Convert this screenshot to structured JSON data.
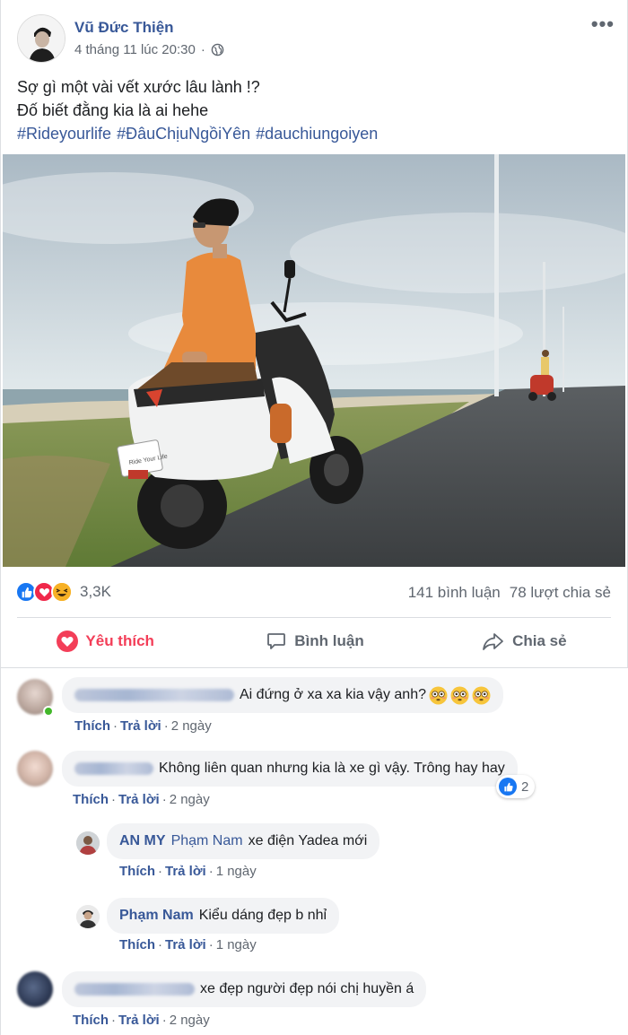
{
  "post": {
    "author": "Vũ Đức Thiện",
    "timestamp": "4 tháng 11 lúc 20:30",
    "privacy_icon": "globe-icon",
    "more_icon": "ellipsis-icon",
    "more_label": "•••",
    "caption_lines": [
      "Sợ gì một vài vết xước lâu lành !?",
      "Đố biết đằng kia là ai hehe"
    ],
    "hashtags": [
      "#Rideyourlife",
      "#ĐâuChịuNgồiYên",
      "#dauchiungoiyen"
    ],
    "photo_plate_text": "Ride Your Life"
  },
  "stats": {
    "reactions": [
      "like",
      "love",
      "haha"
    ],
    "reaction_count": "3,3K",
    "comments": "141 bình luận",
    "shares": "78 lượt chia sẻ"
  },
  "actions": {
    "like": "Yêu thích",
    "comment": "Bình luận",
    "share": "Chia sẻ"
  },
  "colors": {
    "link": "#385898",
    "love": "#f33e58",
    "like": "#1877f2",
    "muted": "#606770",
    "bubble": "#f2f3f5"
  },
  "comments": [
    {
      "name_blurred": true,
      "text": "Ai đứng ở xa xa kia vậy anh?",
      "emoji": [
        "flushed-face-icon",
        "flushed-face-icon",
        "flushed-face-icon"
      ],
      "like": "Thích",
      "reply": "Trả lời",
      "time": "2 ngày"
    },
    {
      "name_blurred": true,
      "text": "Không liên quan nhưng kia là xe gì vậy. Trông hay hay",
      "like": "Thích",
      "reply": "Trả lời",
      "time": "2 ngày",
      "like_count": "2"
    },
    {
      "name": "AN MY",
      "tag": "Phạm Nam",
      "text": "xe điện Yadea mới",
      "like": "Thích",
      "reply": "Trả lời",
      "time": "1 ngày"
    },
    {
      "name": "Phạm Nam",
      "text": "Kiểu dáng đẹp b nhỉ",
      "like": "Thích",
      "reply": "Trả lời",
      "time": "1 ngày"
    },
    {
      "name_blurred": true,
      "text": "xe đẹp người đẹp nói chị huyền á",
      "like": "Thích",
      "reply": "Trả lời",
      "time": "2 ngày"
    }
  ]
}
